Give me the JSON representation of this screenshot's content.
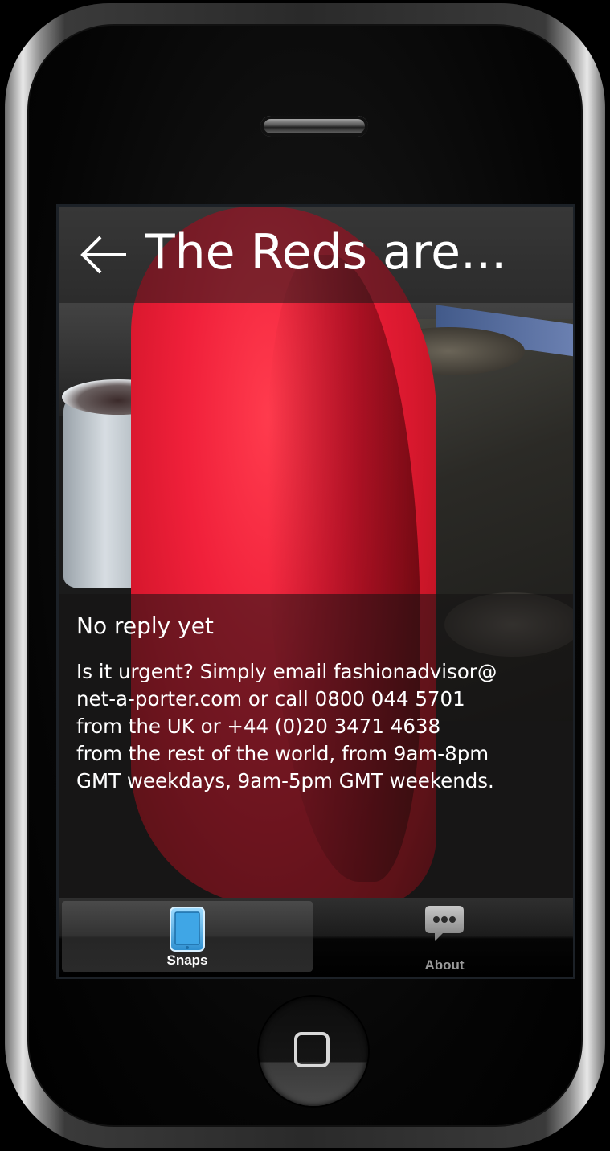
{
  "header": {
    "title": "The Reds are...",
    "back_icon": "back-arrow-icon"
  },
  "message": {
    "status": "No reply yet",
    "body": "Is it urgent? Simply email fashionadvisor@\nnet-a-porter.com or call 0800 044 5701\nfrom the UK or +44 (0)20 3471 4638\nfrom the rest of the world, from 9am-8pm\nGMT weekdays, 9am-5pm GMT weekends."
  },
  "tabs": [
    {
      "label": "Snaps",
      "icon": "tablet-icon",
      "selected": true
    },
    {
      "label": "About",
      "icon": "speech-bubble-icon",
      "selected": false
    }
  ],
  "colors": {
    "tab_selected_icon": "#5ab4e8",
    "garment": "#e81d34"
  }
}
